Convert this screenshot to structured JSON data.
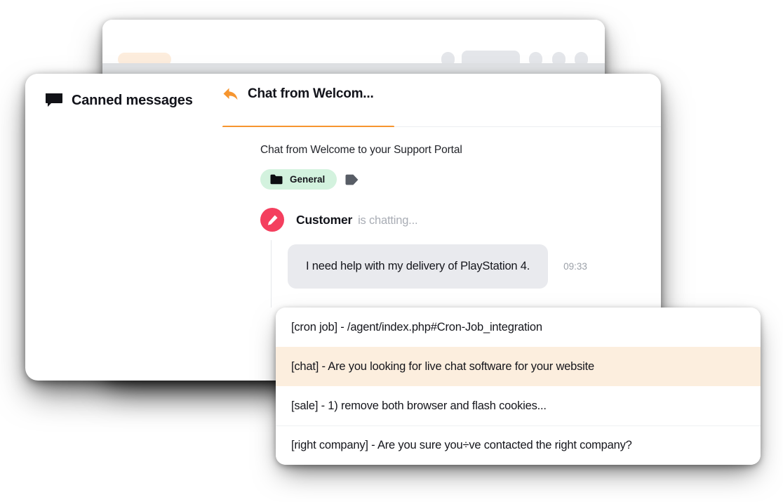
{
  "app_window": {
    "skeleton": {
      "toolbar_accent_pill": "",
      "toolbar_dots": 4,
      "list_rows": 4
    },
    "composer": {
      "chat_icon": "chat-bubble-icon",
      "accent_color": "#f6952f"
    }
  },
  "header": {
    "canned": {
      "icon": "chat-bubble-icon",
      "label": "Canned messages"
    },
    "tab": {
      "icon": "reply-arrow-icon",
      "label": "Chat from Welcom...",
      "active": true,
      "underline_color": "#f6952f"
    }
  },
  "conversation": {
    "subject": "Chat from Welcome to your Support Portal",
    "tags": [
      {
        "icon": "folder-icon",
        "label": "General",
        "bg": "#d3f2de"
      }
    ],
    "add_tag_icon": "tag-icon",
    "sender": {
      "avatar_icon": "pencil-icon",
      "avatar_color": "#f43f5e",
      "name": "Customer",
      "status": "is chatting..."
    },
    "message": {
      "text": "I need help with my delivery of PlayStation 4.",
      "time": "09:33",
      "bubble_bg": "#e9eaee"
    }
  },
  "dropdown": {
    "highlight_color": "#fceede",
    "items": [
      {
        "label": "[cron job] - /agent/index.php#Cron-Job_integration",
        "active": false
      },
      {
        "label": "[chat] - Are you looking for live chat software for your website",
        "active": true
      },
      {
        "label": "[sale] - 1) remove both browser and flash cookies...",
        "active": false
      },
      {
        "label": "[right company] - Are you sure you÷ve contacted the right company?",
        "active": false
      }
    ]
  }
}
